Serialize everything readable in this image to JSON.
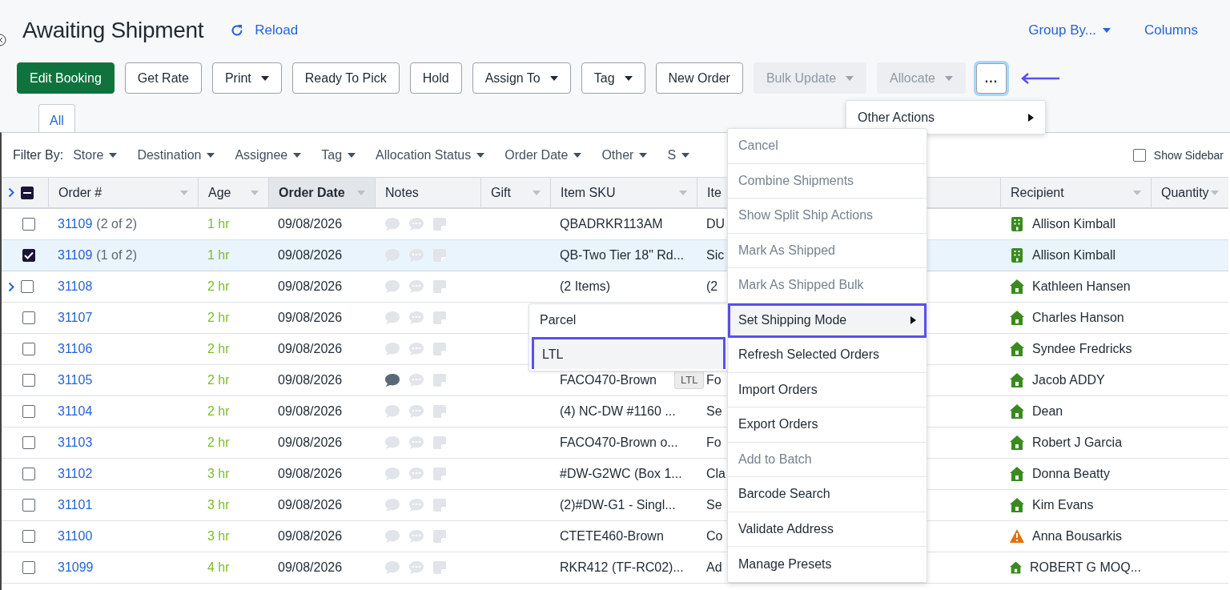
{
  "page": {
    "title": "Awaiting Shipment",
    "reload": "Reload",
    "group_by": "Group By...",
    "columns_link": "Columns"
  },
  "toolbar": [
    {
      "label": "Edit Booking",
      "kind": "primary",
      "dropdown": false,
      "disabled": false
    },
    {
      "label": "Get Rate",
      "kind": "plain",
      "dropdown": false,
      "disabled": false
    },
    {
      "label": "Print",
      "kind": "plain",
      "dropdown": true,
      "disabled": false
    },
    {
      "label": "Ready To Pick",
      "kind": "plain",
      "dropdown": false,
      "disabled": false
    },
    {
      "label": "Hold",
      "kind": "plain",
      "dropdown": false,
      "disabled": false
    },
    {
      "label": "Assign To",
      "kind": "plain",
      "dropdown": true,
      "disabled": false
    },
    {
      "label": "Tag",
      "kind": "plain",
      "dropdown": true,
      "disabled": false
    },
    {
      "label": "New Order",
      "kind": "plain",
      "dropdown": false,
      "disabled": false
    },
    {
      "label": "Bulk Update",
      "kind": "plain",
      "dropdown": true,
      "disabled": true
    },
    {
      "label": "Allocate",
      "kind": "plain",
      "dropdown": true,
      "disabled": true
    },
    {
      "label": "...",
      "kind": "more",
      "dropdown": false,
      "disabled": false
    }
  ],
  "tabs": [
    {
      "label": "All",
      "selected": true
    }
  ],
  "filter_bar": {
    "label": "Filter By:",
    "filters": [
      "Store",
      "Destination",
      "Assignee",
      "Tag",
      "Allocation Status",
      "Order Date",
      "Other",
      "S"
    ],
    "show_sidebar": {
      "label": "Show Sidebar",
      "checked": false
    }
  },
  "table": {
    "select_all": {
      "indeterminate": true,
      "expandable": true
    },
    "columns": [
      {
        "label": "Order #",
        "sorted": false,
        "menu": true
      },
      {
        "label": "Age",
        "sorted": false,
        "menu": true
      },
      {
        "label": "Order Date",
        "sorted": true,
        "menu": true
      },
      {
        "label": "Notes",
        "sorted": false,
        "menu": false
      },
      {
        "label": "Gift",
        "sorted": false,
        "menu": true
      },
      {
        "label": "Item SKU",
        "sorted": false,
        "menu": true
      },
      {
        "label": "Ite",
        "sorted": false,
        "menu": false
      },
      {
        "label": "Recipient",
        "sorted": false,
        "menu": true
      },
      {
        "label": "Quantity",
        "sorted": false,
        "menu": true
      }
    ],
    "rows": [
      {
        "order": "31109",
        "split": "(2 of 2)",
        "age": "1 hr",
        "date": "09/08/2026",
        "has_note": false,
        "sku": "QBADRKR113AM",
        "item": "DU",
        "recipient": {
          "name": "Allison Kimball",
          "kind": "business"
        },
        "checked": false,
        "expandable": false
      },
      {
        "order": "31109",
        "split": "(1 of 2)",
        "age": "1 hr",
        "date": "09/08/2026",
        "has_note": false,
        "sku": "QB-Two Tier 18\" Rd...",
        "item": "Sic",
        "recipient": {
          "name": "Allison Kimball",
          "kind": "business"
        },
        "checked": true,
        "expandable": false
      },
      {
        "order": "31108",
        "age": "2 hr",
        "date": "09/08/2026",
        "has_note": false,
        "sku": "(2 Items)",
        "item": "(2",
        "recipient": {
          "name": "Kathleen Hansen",
          "kind": "home"
        },
        "checked": false,
        "expandable": true
      },
      {
        "order": "31107",
        "age": "2 hr",
        "date": "09/08/2026",
        "has_note": false,
        "recipient": {
          "name": "Charles Hanson",
          "kind": "home"
        },
        "checked": false,
        "expandable": false
      },
      {
        "order": "31106",
        "age": "2 hr",
        "date": "09/08/2026",
        "has_note": false,
        "recipient": {
          "name": "Syndee Fredricks",
          "kind": "home"
        },
        "checked": false,
        "expandable": false
      },
      {
        "order": "31105",
        "age": "2 hr",
        "date": "09/08/2026",
        "has_note": true,
        "sku": "FACO470-Brown",
        "item": "Fo",
        "recipient": {
          "name": "Jacob ADDY",
          "kind": "home"
        },
        "checked": false,
        "expandable": false
      },
      {
        "order": "31104",
        "age": "2 hr",
        "date": "09/08/2026",
        "has_note": false,
        "sku": "(4) NC-DW #1160 ...",
        "item": "Se",
        "recipient": {
          "name": "Dean",
          "kind": "home"
        },
        "checked": false,
        "expandable": false
      },
      {
        "order": "31103",
        "age": "2 hr",
        "date": "09/08/2026",
        "has_note": false,
        "sku": "FACO470-Brown o...",
        "item": "Fo",
        "recipient": {
          "name": "Robert J Garcia",
          "kind": "home"
        },
        "checked": false,
        "expandable": false
      },
      {
        "order": "31102",
        "age": "3 hr",
        "date": "09/08/2026",
        "has_note": false,
        "sku": "#DW-G2WC (Box 1...",
        "item": "Cla",
        "recipient": {
          "name": "Donna Beatty",
          "kind": "home"
        },
        "checked": false,
        "expandable": false
      },
      {
        "order": "31101",
        "age": "3 hr",
        "date": "09/08/2026",
        "has_note": false,
        "sku": "(2)#DW-G1 - Singl...",
        "item": "Se",
        "recipient": {
          "name": "Kim Evans",
          "kind": "home"
        },
        "checked": false,
        "expandable": false
      },
      {
        "order": "31100",
        "age": "3 hr",
        "date": "09/08/2026",
        "has_note": false,
        "sku": "CTETE460-Brown",
        "item": "Co",
        "recipient": {
          "name": "Anna Bousarkis",
          "kind": "warning"
        },
        "checked": false,
        "expandable": false
      },
      {
        "order": "31099",
        "age": "4 hr",
        "date": "09/08/2026",
        "has_note": false,
        "sku": "RKR412 (TF-RC02)...",
        "item": "Ad",
        "recipient": {
          "name": "ROBERT G MOQ...",
          "kind": "home"
        },
        "checked": false,
        "expandable": false
      }
    ]
  },
  "other_actions": {
    "label": "Other Actions"
  },
  "actions_menu": [
    {
      "label": "Cancel",
      "disabled": true,
      "highlighted": false,
      "submenu": false
    },
    {
      "label": "Combine Shipments",
      "disabled": true,
      "highlighted": false,
      "submenu": false
    },
    {
      "label": "Show Split Ship Actions",
      "disabled": true,
      "highlighted": false,
      "submenu": false
    },
    {
      "label": "Mark As Shipped",
      "disabled": true,
      "highlighted": false,
      "submenu": false
    },
    {
      "label": "Mark As Shipped Bulk",
      "disabled": true,
      "highlighted": false,
      "submenu": false
    },
    {
      "label": "Set Shipping Mode",
      "disabled": false,
      "highlighted": true,
      "submenu": true
    },
    {
      "label": "Refresh Selected Orders",
      "disabled": false,
      "highlighted": false,
      "submenu": false
    },
    {
      "label": "Import Orders",
      "disabled": false,
      "highlighted": false,
      "submenu": false
    },
    {
      "label": "Export Orders",
      "disabled": false,
      "highlighted": false,
      "submenu": false
    },
    {
      "label": "Add to Batch",
      "disabled": true,
      "highlighted": false,
      "submenu": false
    },
    {
      "label": "Barcode Search",
      "disabled": false,
      "highlighted": false,
      "submenu": false
    },
    {
      "label": "Validate Address",
      "disabled": false,
      "highlighted": false,
      "submenu": false
    },
    {
      "label": "Manage Presets",
      "disabled": false,
      "highlighted": false,
      "submenu": false
    }
  ],
  "shipping_mode_menu": [
    {
      "label": "Parcel",
      "selected": false
    },
    {
      "label": "LTL",
      "selected": true
    }
  ],
  "tooltip": "LTL"
}
